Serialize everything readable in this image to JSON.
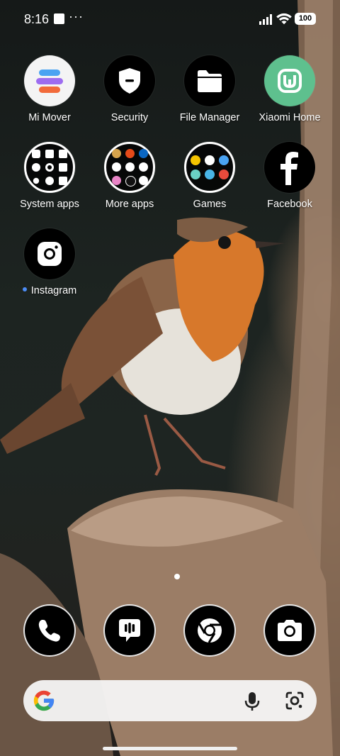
{
  "status_bar": {
    "time": "8:16",
    "battery": "100",
    "icons": [
      "notification-square-icon",
      "more-dots-icon",
      "signal-icon",
      "wifi-icon",
      "battery-icon"
    ]
  },
  "apps": [
    {
      "label": "Mi Mover",
      "icon": "mi-mover-icon"
    },
    {
      "label": "Security",
      "icon": "security-shield-icon"
    },
    {
      "label": "File Manager",
      "icon": "folder-icon"
    },
    {
      "label": "Xiaomi Home",
      "icon": "xiaomi-home-icon"
    },
    {
      "label": "System apps",
      "icon": "folder-icon"
    },
    {
      "label": "More apps",
      "icon": "folder-icon"
    },
    {
      "label": "Games",
      "icon": "folder-icon"
    },
    {
      "label": "Facebook",
      "icon": "facebook-icon"
    },
    {
      "label": "Instagram",
      "icon": "instagram-icon",
      "new_indicator": true
    }
  ],
  "dock": [
    {
      "name": "phone",
      "icon": "phone-icon"
    },
    {
      "name": "messages",
      "icon": "messages-icon"
    },
    {
      "name": "chrome",
      "icon": "chrome-icon"
    },
    {
      "name": "camera",
      "icon": "camera-icon"
    }
  ],
  "search": {
    "icons": [
      "google-g-icon",
      "microphone-icon",
      "lens-icon"
    ]
  },
  "colors": {
    "accent_blue": "#4c8cf5",
    "xiaomi_green": "#5ec08e",
    "google_blue": "#4285f4",
    "google_red": "#ea4335",
    "google_yellow": "#fbbc05",
    "google_green": "#34a853"
  }
}
